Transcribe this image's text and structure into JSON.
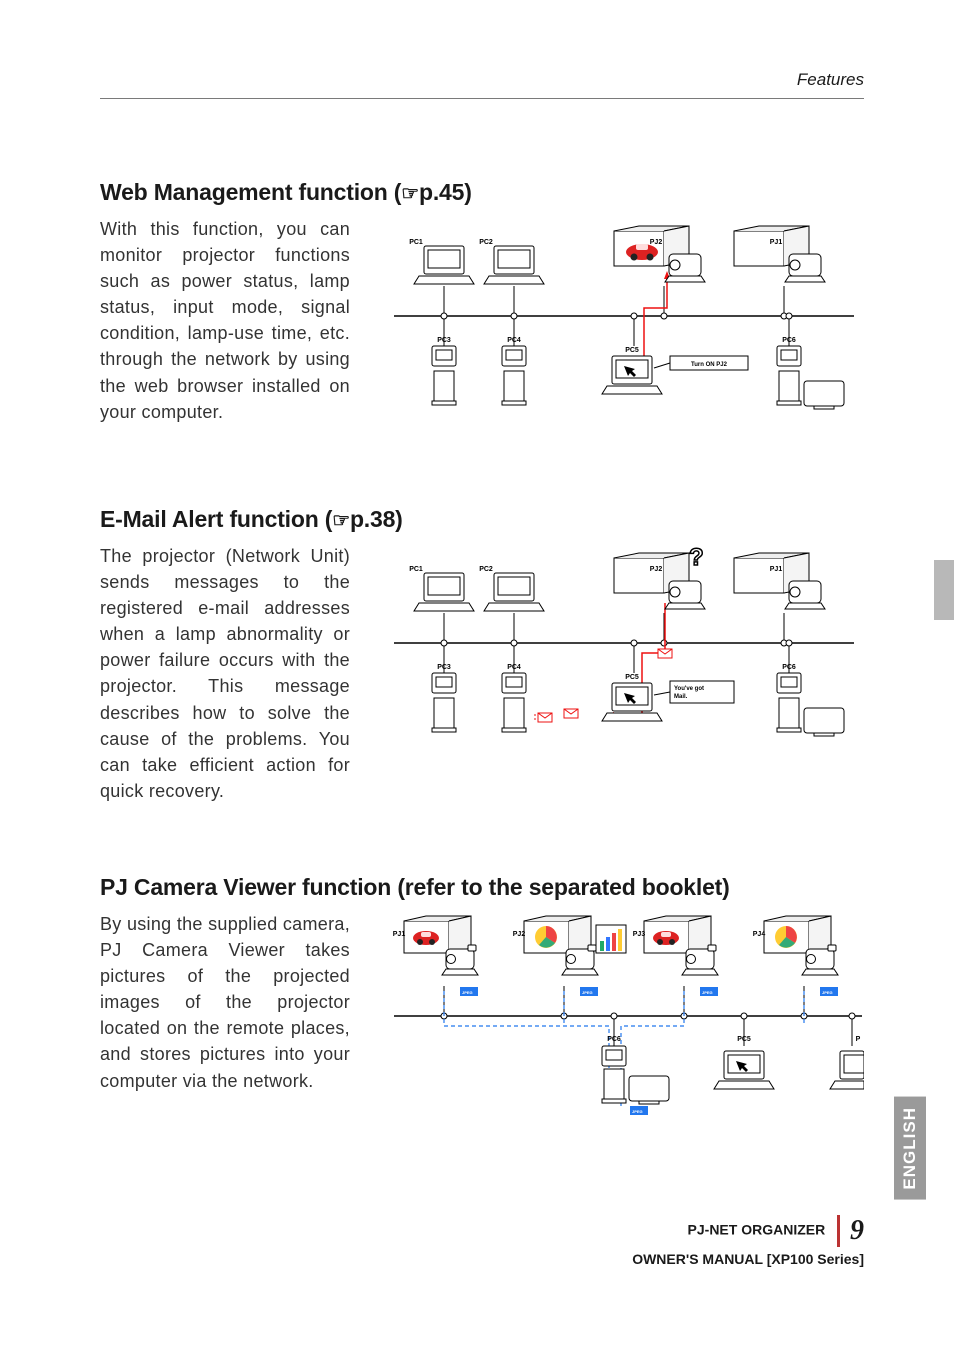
{
  "header": {
    "section_name": "Features"
  },
  "section1": {
    "title_prefix": "Web Management function (",
    "title_ref": "p.45)",
    "body": "With this function, you can monitor projector functions such as power status, lamp status, input mode, signal condition, lamp-use time, etc. through the network by using the web browser installed on your computer.",
    "diagram": {
      "pc1": "PC1",
      "pc2": "PC2",
      "pj2": "PJ2",
      "pj1": "PJ1",
      "pc3": "PC3",
      "pc4": "PC4",
      "pc5": "PC5",
      "pc6": "PC6",
      "callout": "Turn ON  PJ2"
    }
  },
  "section2": {
    "title_prefix": "E-Mail Alert function (",
    "title_ref": "p.38)",
    "body": "The projector (Network Unit) sends messages to the registered e-mail addresses when a lamp abnormality or power failure occurs with the projector. This message describes how to solve the cause of the problems. You can take efficient action for quick recovery.",
    "diagram": {
      "pc1": "PC1",
      "pc2": "PC2",
      "pj2": "PJ2",
      "pj1": "PJ1",
      "pc3": "PC3",
      "pc4": "PC4",
      "pc5": "PC5",
      "pc6": "PC6",
      "callout": "You've got Mail."
    }
  },
  "section3": {
    "title": "PJ Camera Viewer function (refer to the separated booklet)",
    "body": "By using the supplied camera, PJ Camera Viewer takes pictures of the projected images of the projector located on the remote places, and stores pictures into your computer via the network.",
    "diagram": {
      "pj1": "PJ1",
      "pj2": "PJ2",
      "pj3": "PJ3",
      "pj4": "PJ4",
      "pc6": "PC6",
      "pc5": "PC5",
      "p": "P",
      "jpeg": "JPEG"
    }
  },
  "footer": {
    "line1": "PJ-NET ORGANIZER",
    "line2": "OWNER'S MANUAL [XP100 Series]",
    "page": "9"
  },
  "language_tab": "ENGLISH"
}
